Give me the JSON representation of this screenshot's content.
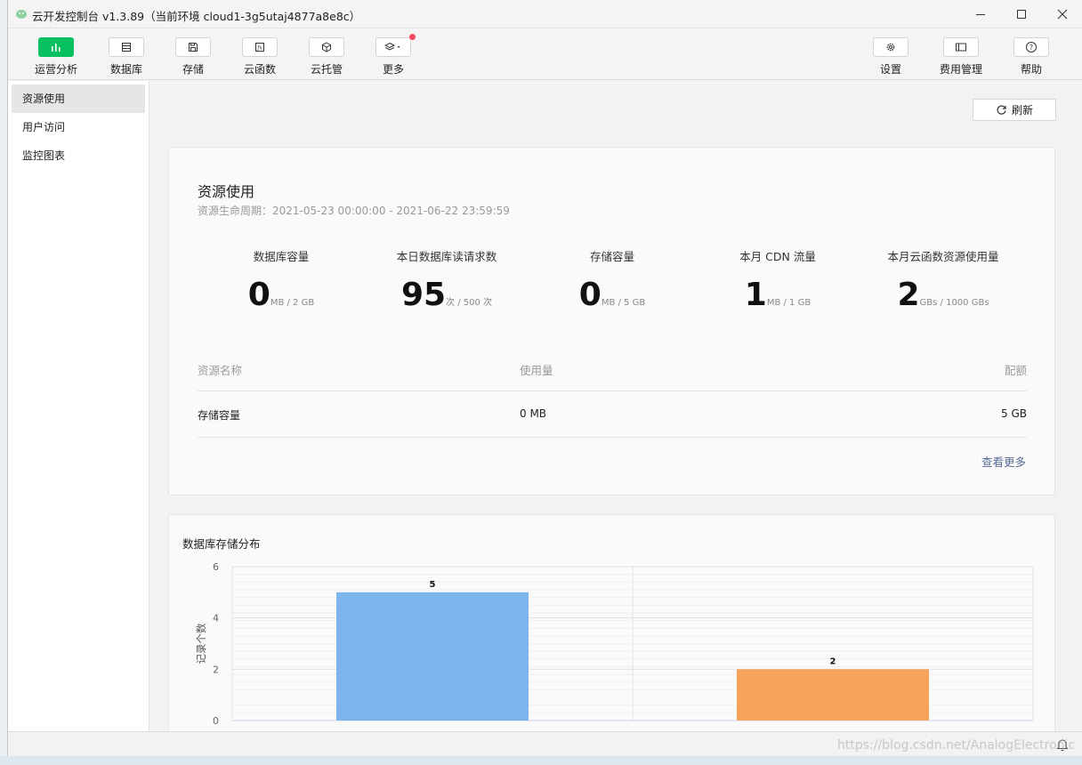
{
  "window": {
    "title": "云开发控制台 v1.3.89（当前环境 cloud1-3g5utaj4877a8e8c）"
  },
  "toolbar": {
    "left": [
      {
        "label": "运营分析",
        "icon": "bar-chart-icon",
        "active": true
      },
      {
        "label": "数据库",
        "icon": "database-icon"
      },
      {
        "label": "存储",
        "icon": "storage-icon"
      },
      {
        "label": "云函数",
        "icon": "function-icon"
      },
      {
        "label": "云托管",
        "icon": "cube-icon"
      },
      {
        "label": "更多",
        "icon": "layers-icon",
        "badge": true
      }
    ],
    "right": [
      {
        "label": "设置",
        "icon": "gear-icon"
      },
      {
        "label": "费用管理",
        "icon": "wallet-icon"
      },
      {
        "label": "帮助",
        "icon": "help-icon"
      }
    ]
  },
  "sidebar": {
    "items": [
      {
        "label": "资源使用",
        "active": true
      },
      {
        "label": "用户访问"
      },
      {
        "label": "监控图表"
      }
    ]
  },
  "main": {
    "refresh_label": "刷新",
    "resource": {
      "title": "资源使用",
      "subtitle": "资源生命周期：2021-05-23 00:00:00 - 2021-06-22 23:59:59",
      "metrics": [
        {
          "label": "数据库容量",
          "value": "0",
          "unit": "MB / 2 GB"
        },
        {
          "label": "本日数据库读请求数",
          "value": "95",
          "unit": "次 / 500 次"
        },
        {
          "label": "存储容量",
          "value": "0",
          "unit": "MB / 5 GB"
        },
        {
          "label": "本月 CDN 流量",
          "value": "1",
          "unit": "MB / 1 GB"
        },
        {
          "label": "本月云函数资源使用量",
          "value": "2",
          "unit": "GBs / 1000 GBs"
        }
      ],
      "table": {
        "headers": [
          "资源名称",
          "使用量",
          "配额"
        ],
        "rows": [
          [
            "存储容量",
            "0 MB",
            "5 GB"
          ]
        ]
      },
      "more_link": "查看更多"
    },
    "chart_title": "数据库存储分布"
  },
  "chart_data": {
    "type": "bar",
    "title": "数据库存储分布",
    "ylabel": "记录个数",
    "ylim": [
      0,
      6
    ],
    "yticks": [
      0,
      2,
      4,
      6
    ],
    "values": [
      5,
      2
    ],
    "colors": [
      "#7cb5ec",
      "#f7a35c"
    ],
    "grid": true
  },
  "statusbar": {
    "watermark": "https://blog.csdn.net/AnalogElectronic"
  },
  "colors": {
    "accent": "#07c160",
    "link": "#576b95",
    "badge": "#f5475e"
  }
}
